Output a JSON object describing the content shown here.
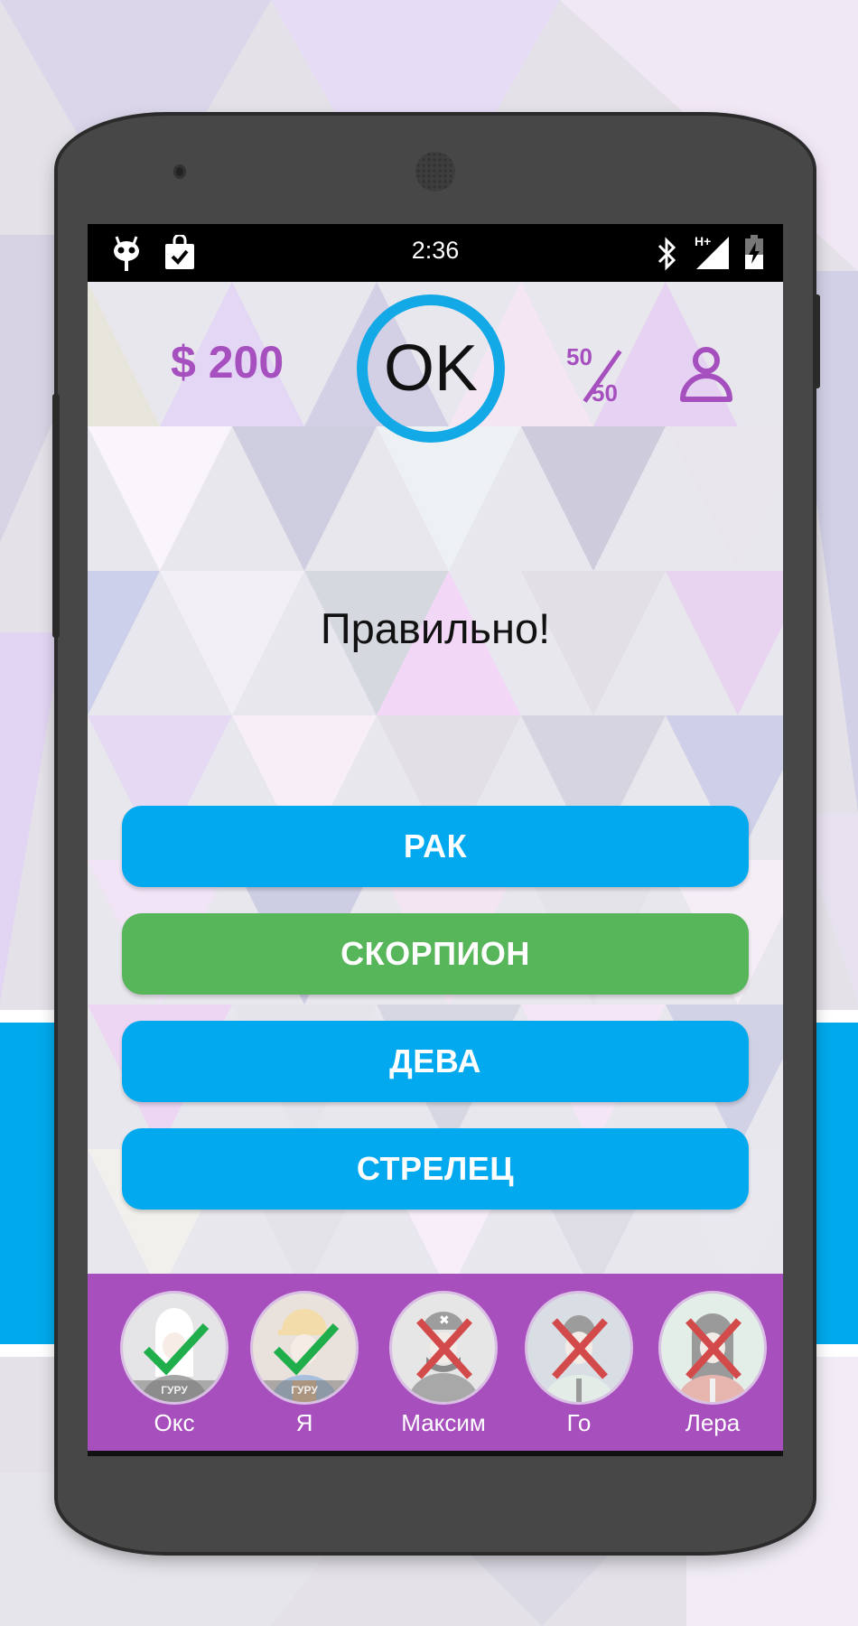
{
  "statusbar": {
    "time": "2:36",
    "left_icons": [
      "cyanogen-mascot-icon",
      "shopping-bag-check-icon"
    ],
    "right_icons": [
      "bluetooth-icon",
      "signal-hplus-icon",
      "battery-charging-icon"
    ],
    "network_label": "H+"
  },
  "header": {
    "money": "$ 200",
    "timer_label": "OK",
    "fifty_fifty": {
      "top": "50",
      "bottom": "50"
    },
    "profile_icon": "person-icon"
  },
  "message": "Правильно!",
  "answers": [
    {
      "label": "РАК",
      "state": "default",
      "color": "#03a9ee"
    },
    {
      "label": "СКОРПИОН",
      "state": "correct",
      "color": "#57b55a"
    },
    {
      "label": "ДЕВА",
      "state": "default",
      "color": "#03a9ee"
    },
    {
      "label": "СТРЕЛЕЦ",
      "state": "default",
      "color": "#03a9ee"
    }
  ],
  "players": [
    {
      "name": "Окс",
      "result": "correct",
      "badge": "ГУРУ"
    },
    {
      "name": "Я",
      "result": "correct",
      "badge": "ГУРУ"
    },
    {
      "name": "Максим",
      "result": "wrong",
      "badge": ""
    },
    {
      "name": "Го",
      "result": "wrong",
      "badge": ""
    },
    {
      "name": "Лера",
      "result": "wrong",
      "badge": ""
    }
  ],
  "colors": {
    "accent_purple": "#a84fbe",
    "answer_blue": "#03a9ee",
    "answer_green": "#57b55a",
    "timer_ring": "#13a8e6",
    "check_green": "#1fae4b",
    "cross_red": "#d24a4a"
  }
}
